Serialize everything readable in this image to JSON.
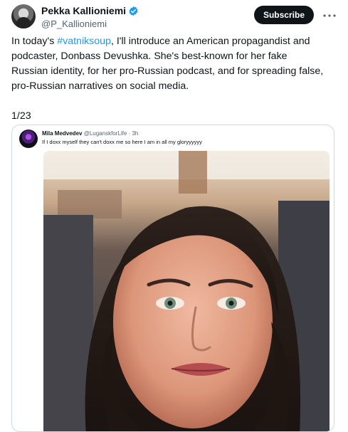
{
  "author": {
    "name": "Pekka Kallioniemi",
    "handle": "@P_Kallioniemi"
  },
  "actions": {
    "subscribe_label": "Subscribe"
  },
  "tweet": {
    "prefix": "In today's ",
    "hashtag": "#vatniksoup",
    "body": ", I'll introduce an American propagandist and podcaster, Donbass Devushka. She's best-known for her fake Russian identity, for her pro-Russian podcast, and for spreading false, pro-Russian narratives on social media.",
    "thread_counter": "1/23"
  },
  "quoted_tweet": {
    "name": "Mila Medvedev",
    "handle": "@LuganskforLife",
    "time": "3h",
    "text": "If I doxx myself they can't doxx me so here I am in all my gloryyyyyy"
  },
  "icons": {
    "verified": "verified-badge-icon",
    "more": "more-options-icon"
  },
  "colors": {
    "accent": "#1d9bf0",
    "text": "#0f1419",
    "muted": "#536471",
    "border": "#cfd9de"
  }
}
